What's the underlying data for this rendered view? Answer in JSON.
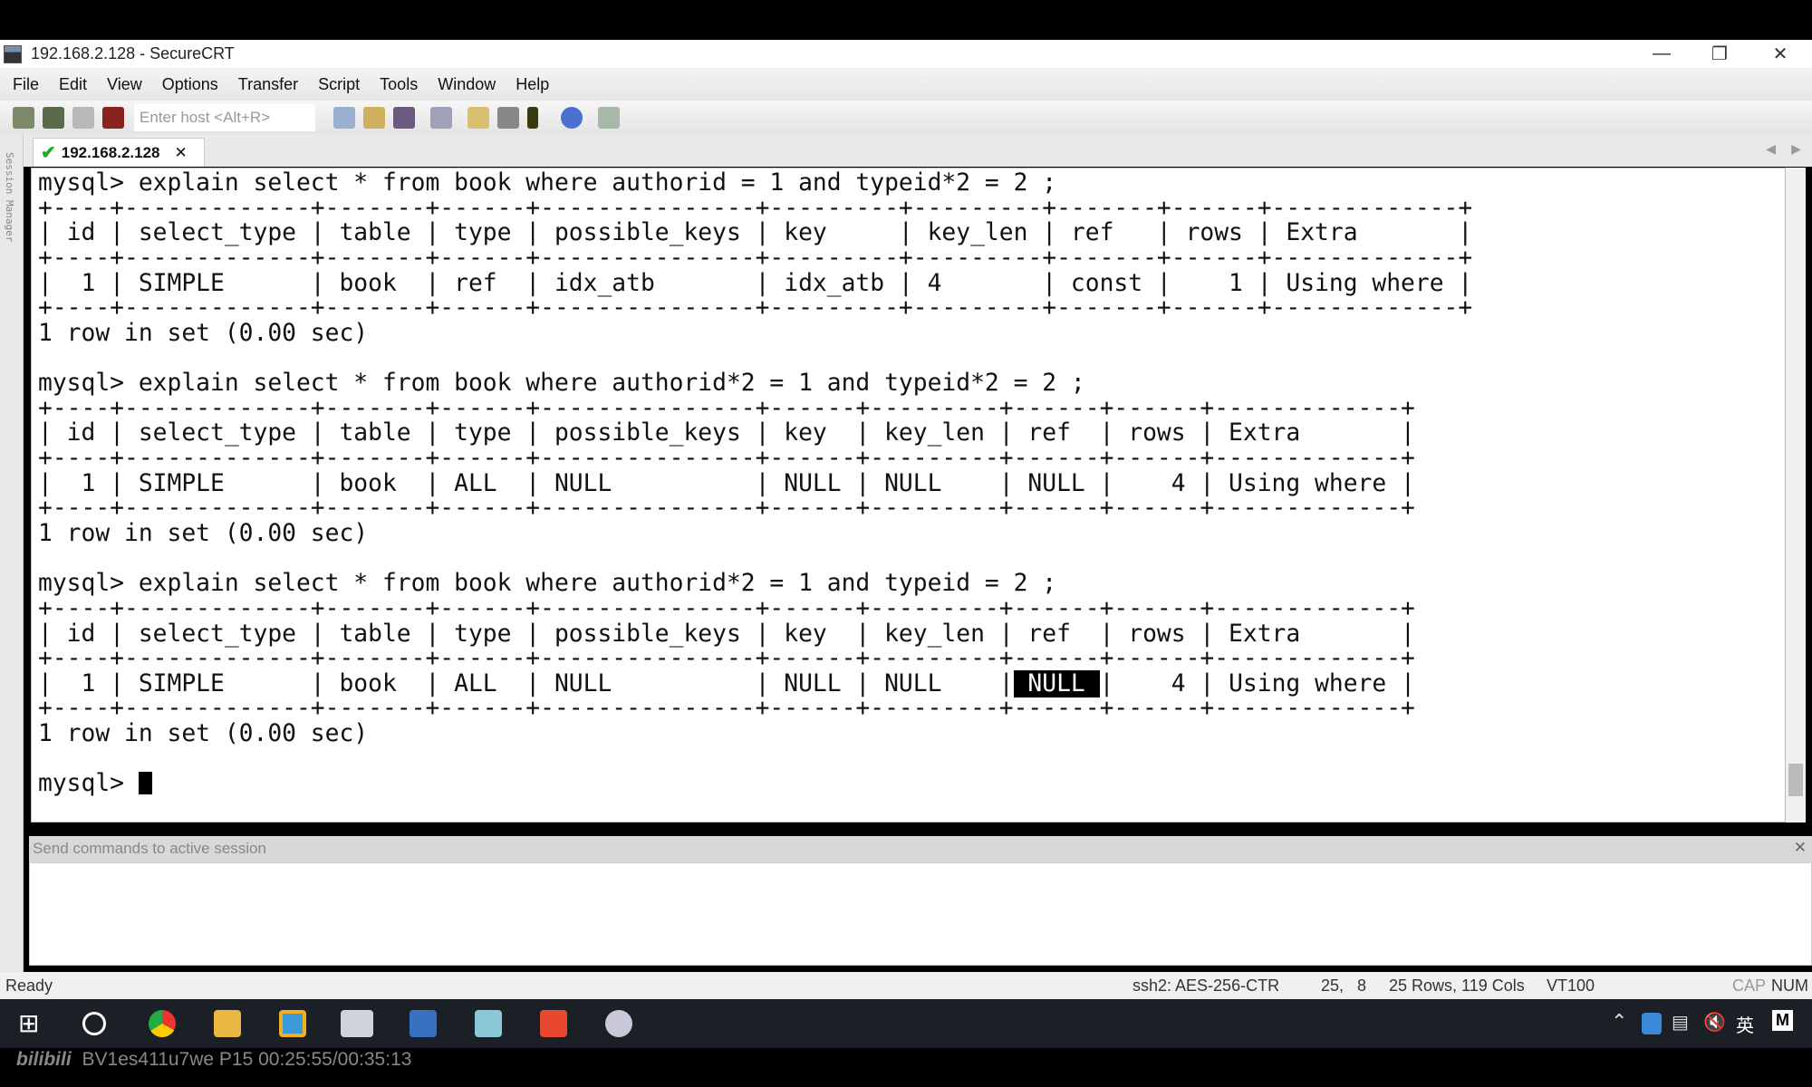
{
  "window": {
    "title": "192.168.2.128 - SecureCRT"
  },
  "menu": [
    "File",
    "Edit",
    "View",
    "Options",
    "Transfer",
    "Script",
    "Tools",
    "Window",
    "Help"
  ],
  "toolbar": {
    "host_placeholder": "Enter host <Alt+R>"
  },
  "session_manager_label": "Session Manager",
  "tab": {
    "label": "192.168.2.128",
    "status": "connected"
  },
  "terminal": {
    "lines": [
      "mysql> explain select * from book where authorid = 1 and typeid*2 = 2 ;",
      "+----+-------------+-------+------+---------------+---------+---------+-------+------+-------------+",
      "| id | select_type | table | type | possible_keys | key     | key_len | ref   | rows | Extra       |",
      "+----+-------------+-------+------+---------------+---------+---------+-------+------+-------------+",
      "|  1 | SIMPLE      | book  | ref  | idx_atb       | idx_atb | 4       | const |    1 | Using where |",
      "+----+-------------+-------+------+---------------+---------+---------+-------+------+-------------+",
      "1 row in set (0.00 sec)",
      "",
      "mysql> explain select * from book where authorid*2 = 1 and typeid*2 = 2 ;",
      "+----+-------------+-------+------+---------------+------+---------+------+------+-------------+",
      "| id | select_type | table | type | possible_keys | key  | key_len | ref  | rows | Extra       |",
      "+----+-------------+-------+------+---------------+------+---------+------+------+-------------+",
      "|  1 | SIMPLE      | book  | ALL  | NULL          | NULL | NULL    | NULL |    4 | Using where |",
      "+----+-------------+-------+------+---------------+------+---------+------+------+-------------+",
      "1 row in set (0.00 sec)",
      "",
      "mysql> explain select * from book where authorid*2 = 1 and typeid = 2 ;",
      "+----+-------------+-------+------+---------------+------+---------+------+------+-------------+",
      "| id | select_type | table | type | possible_keys | key  | key_len | ref  | rows | Extra       |",
      "+----+-------------+-------+------+---------------+------+---------+------+------+-------------+"
    ],
    "selected_row": {
      "before": "|  1 | SIMPLE      | book  | ALL  | NULL          | NULL | NULL    |",
      "selected": " NULL ",
      "after": "|    4 | Using where |"
    },
    "after_lines": [
      "+----+-------------+-------+------+---------------+------+---------+------+------+-------------+",
      "1 row in set (0.00 sec)",
      ""
    ],
    "prompt": "mysql> "
  },
  "send_bar": {
    "placeholder": "Send commands to active session"
  },
  "status": {
    "ready": "Ready",
    "cipher": "ssh2: AES-256-CTR",
    "cursor_pos": "25,   8",
    "size": "25 Rows, 119 Cols",
    "emulation": "VT100",
    "cap": "CAP",
    "num": "NUM"
  },
  "tray": {
    "ime": "英",
    "m": "M"
  },
  "watermark": {
    "text": "BV1es411u7we P15 00:25:55/00:35:13",
    "logo": "bilibili"
  }
}
